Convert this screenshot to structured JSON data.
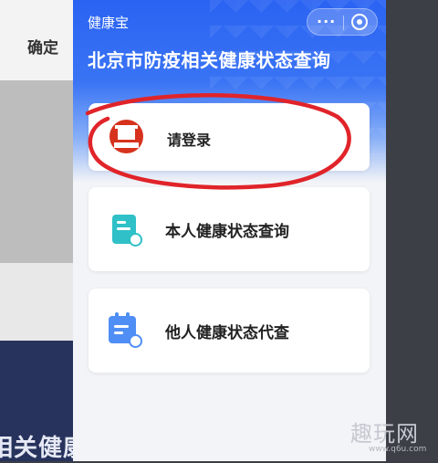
{
  "background": {
    "top_text": "确定",
    "bottom_text": "相关健康"
  },
  "header": {
    "app_name": "健康宝",
    "more_icon": "more-dots-icon",
    "close_icon": "close-circle-icon",
    "title": "北京市防疫相关健康状态查询"
  },
  "cards": {
    "login": {
      "label": "请登录",
      "icon": "beijing-emblem-icon"
    },
    "self_query": {
      "label": "本人健康状态查询",
      "icon": "document-check-icon"
    },
    "others_query": {
      "label": "他人健康状态代查",
      "icon": "calendar-search-icon"
    }
  },
  "annotation": {
    "color": "#e0242a"
  },
  "watermark": {
    "main": "趣玩网",
    "sub": "www.q6u.com"
  },
  "colors": {
    "header_blue": "#2a63f2",
    "teal": "#2fc1c7",
    "blue_icon": "#4f8ef5",
    "emblem_red": "#d6321d"
  }
}
